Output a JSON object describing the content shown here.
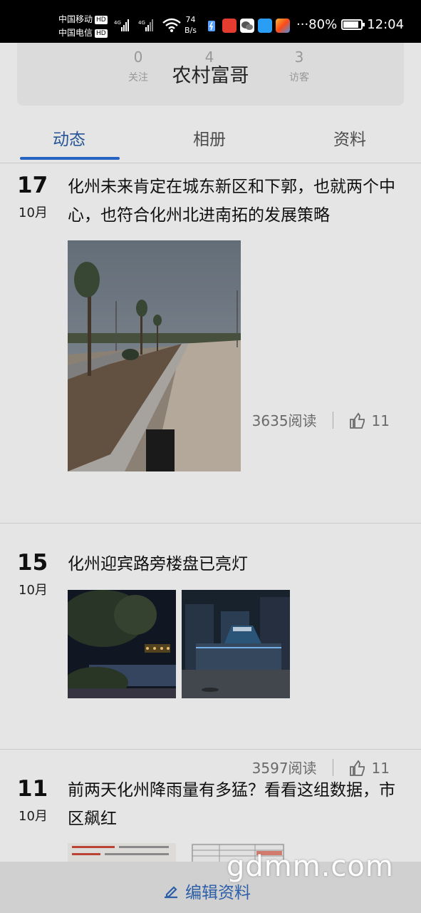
{
  "status_bar": {
    "carrier1": "中国移动",
    "carrier2": "中国电信",
    "hd": "HD",
    "net_speed_value": "74",
    "net_speed_unit": "B/s",
    "battery": "80%",
    "time": "12:04"
  },
  "header": {
    "title": "农村富哥",
    "stats": [
      {
        "value": "0",
        "label": "关注"
      },
      {
        "value": "4",
        "label": ""
      },
      {
        "value": "3",
        "label": "访客"
      }
    ]
  },
  "tabs": [
    {
      "label": "动态",
      "active": true
    },
    {
      "label": "相册",
      "active": false
    },
    {
      "label": "资料",
      "active": false
    }
  ],
  "posts": [
    {
      "day": "17",
      "month": "10月",
      "title": "化州未来肯定在城东新区和下郭，也就两个中心，也符合化州北进南拓的发展策略",
      "reads": "3635阅读",
      "likes": "11"
    },
    {
      "day": "15",
      "month": "10月",
      "title": "化州迎宾路旁楼盘已亮灯",
      "reads": "3597阅读",
      "likes": "11"
    },
    {
      "day": "11",
      "month": "10月",
      "title": "前两天化州降雨量有多猛？看看这组数据，市区飙红"
    }
  ],
  "bottom": {
    "edit_label": "编辑资料"
  },
  "watermark": "gdmm.com",
  "colors": {
    "accent": "#2c6fd6",
    "tab_active": "#2c5fa8"
  }
}
